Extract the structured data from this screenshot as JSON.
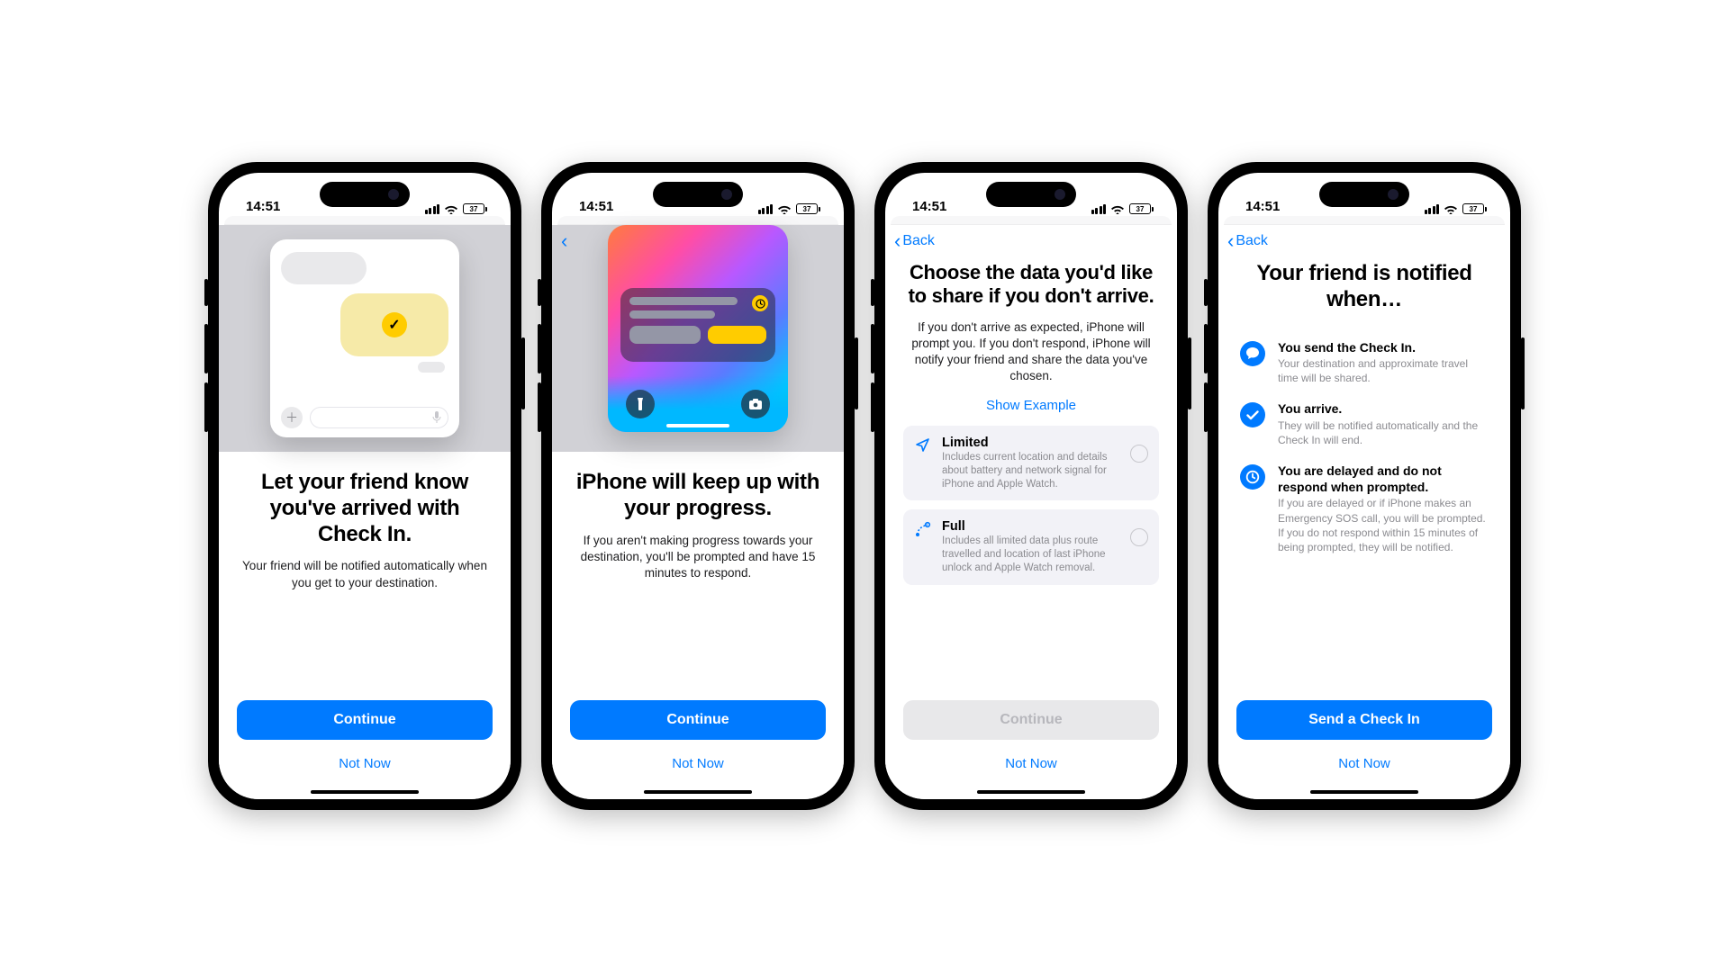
{
  "status": {
    "time": "14:51",
    "battery": "37"
  },
  "nav": {
    "back": "Back"
  },
  "buttons": {
    "continue": "Continue",
    "not_now": "Not Now",
    "send": "Send a Check In"
  },
  "screen1": {
    "title": "Let your friend know you've arrived with Check In.",
    "subtitle": "Your friend will be notified automatically when you get to your destination."
  },
  "screen2": {
    "title": "iPhone will keep up with your progress.",
    "subtitle": "If you aren't making progress towards your destination, you'll be prompted and have 15 minutes to respond."
  },
  "screen3": {
    "title": "Choose the data you'd like to share if you don't arrive.",
    "subtitle": "If you don't arrive as expected, iPhone will prompt you. If you don't respond, iPhone will notify your friend and share the data you've chosen.",
    "link": "Show Example",
    "options": [
      {
        "title": "Limited",
        "desc": "Includes current location and details about battery and network signal for iPhone and Apple Watch."
      },
      {
        "title": "Full",
        "desc": "Includes all limited data plus route travelled and location of last iPhone unlock and Apple Watch removal."
      }
    ]
  },
  "screen4": {
    "title": "Your friend is notified when…",
    "items": [
      {
        "title": "You send the Check In.",
        "desc": "Your destination and approximate travel time will be shared."
      },
      {
        "title": "You arrive.",
        "desc": "They will be notified automatically and the Check In will end."
      },
      {
        "title": "You are delayed and do not respond when prompted.",
        "desc": "If you are delayed or if iPhone makes an Emergency SOS call, you will be prompted. If you do not respond within 15 minutes of being prompted, they will be notified."
      }
    ]
  }
}
